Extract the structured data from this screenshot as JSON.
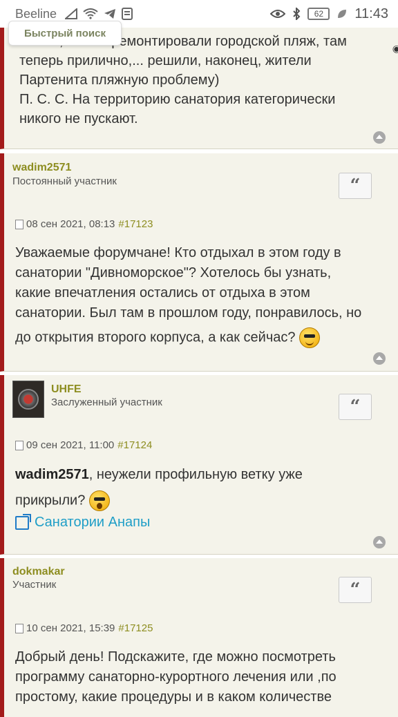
{
  "status_bar": {
    "carrier": "Beeline",
    "battery": "62",
    "time": "11:43"
  },
  "quick_search": {
    "label": "Быстрый поиск"
  },
  "post0": {
    "lines": [
      "пляжа, но и отремонтировали городской пляж, там",
      "теперь прилично,... решили, наконец, жители",
      "Партенита пляжную проблему)",
      "П. С. С. На территорию санатория категорически",
      "никого не пускают."
    ]
  },
  "post1": {
    "author": "wadim2571",
    "rank": "Постоянный участник",
    "date": "08 сен 2021, 08:13",
    "number": "#17123",
    "body_lines": [
      "Уважаемые форумчане! Кто отдыхал в этом году в",
      "санатории \"Дивноморское\"? Хотелось бы узнать,",
      "какие впечатления остались от отдыха в этом",
      "санатории. Был там в прошлом году, понравилось, но",
      "до открытия второго корпуса, а как сейчас?"
    ]
  },
  "post2": {
    "author": "UHFE",
    "rank": "Заслуженный участник",
    "date": "09 сен 2021, 11:00",
    "number": "#17124",
    "mention": "wadim2571",
    "body_rest": ", неужели профильную ветку уже",
    "body_line2": "прикрыли?",
    "link_text": "Санатории Анапы"
  },
  "post3": {
    "author": "dokmakar",
    "rank": "Участник",
    "date": "10 сен 2021, 15:39",
    "number": "#17125",
    "body_lines": [
      "Добрый день! Подскажите, где можно посмотреть",
      "программу санаторно-курортного лечения или ,по",
      "простому, какие процедуры и в каком количестве"
    ]
  },
  "quote_symbol": "“"
}
